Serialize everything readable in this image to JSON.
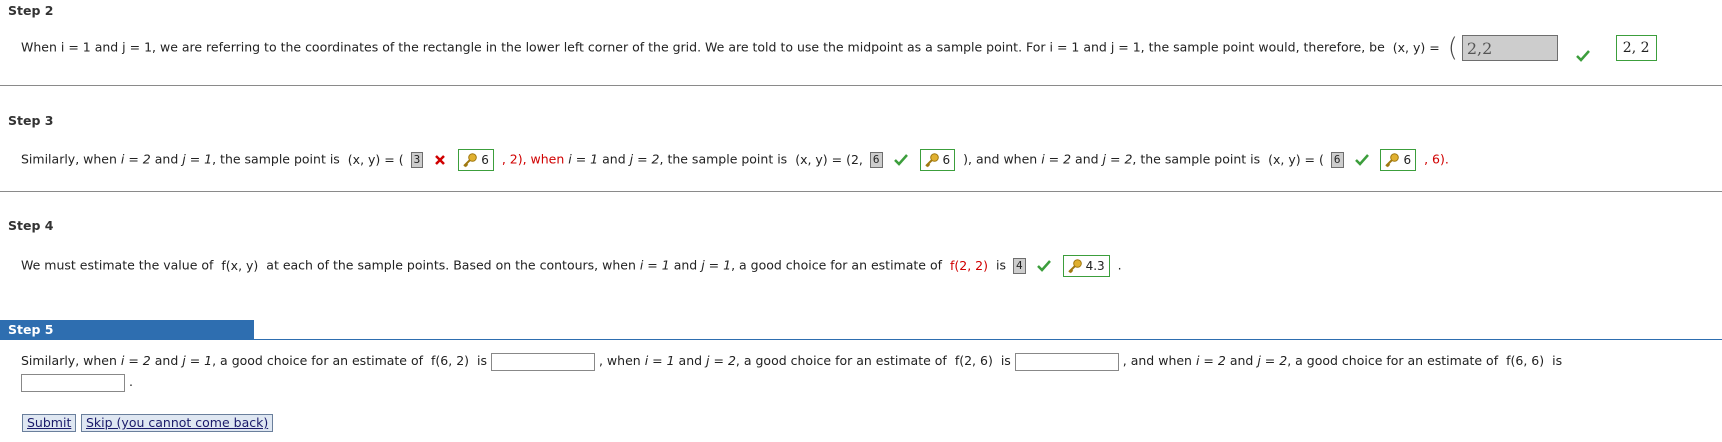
{
  "step2": {
    "title": "Step 2",
    "text": "When i = 1 and j = 1, we are referring to the coordinates of the rectangle in the lower left corner of the grid. We are told to use the midpoint as a sample point. For i = 1 and j = 1, the sample point would, therefore, be",
    "xy": "(x, y) =",
    "answer_value": "2,2",
    "correct_answer": "2, 2"
  },
  "step3": {
    "title": "Step 3",
    "p1": "Similarly, when",
    "p2": "and",
    "p3": ", the sample point is",
    "xy": "(x, y) = (",
    "entry1": "3",
    "key1": "6",
    "after1": ", 2),  when",
    "after1b": ", the sample point is",
    "xy2": "(x, y) = (2,",
    "entry2": "6",
    "key2": "6",
    "after2": "),  and when",
    "xy3": "(x, y) = (",
    "entry3": "6",
    "key3": "6",
    "after3": ", 6)."
  },
  "step4": {
    "title": "Step 4",
    "text": "We must estimate the value of",
    "fxy": "f(x, y)",
    "text2": "at each of the sample points. Based on the contours, when",
    "text3": ", a good choice for an estimate of",
    "f22": "f(2, 2)",
    "is": "is",
    "entry": "4",
    "key": "4.3",
    "end": "."
  },
  "step5": {
    "title": "Step 5",
    "p1": "Similarly, when",
    "p2": ", a good choice for an estimate of",
    "f62": "f(6, 2)",
    "is": "is",
    "when": ", when",
    "f26": "f(2, 6)",
    "andwhen": ", and when",
    "f66": "f(6, 6)",
    "end": "."
  },
  "vars": {
    "i1": "i = 1",
    "j1": "j = 1",
    "i2": "i = 2",
    "j2": "j = 2",
    "and": "and"
  },
  "buttons": {
    "submit": "Submit",
    "skip": "Skip (you cannot come back)"
  },
  "colors": {
    "accent": "#2e6eb0",
    "correct": "#3c9e3c",
    "wrong": "#d00000"
  }
}
